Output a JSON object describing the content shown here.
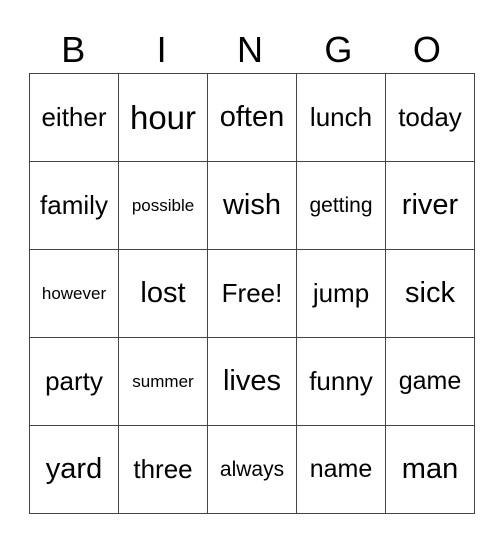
{
  "header": [
    "B",
    "I",
    "N",
    "G",
    "O"
  ],
  "rows": [
    [
      "either",
      "hour",
      "often",
      "lunch",
      "today"
    ],
    [
      "family",
      "possible",
      "wish",
      "getting",
      "river"
    ],
    [
      "however",
      "lost",
      "Free!",
      "jump",
      "sick"
    ],
    [
      "party",
      "summer",
      "lives",
      "funny",
      "game"
    ],
    [
      "yard",
      "three",
      "always",
      "name",
      "man"
    ]
  ]
}
